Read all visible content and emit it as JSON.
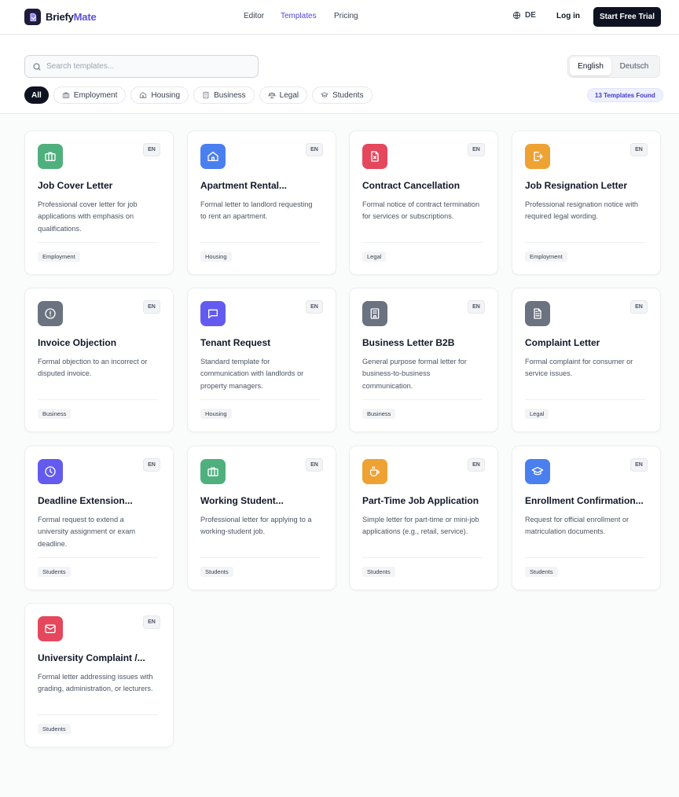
{
  "brand": {
    "name_part1": "Briefy",
    "name_part2": "Mate",
    "accent": "#5b4fe0"
  },
  "nav": {
    "editor": "Editor",
    "templates": "Templates",
    "pricing": "Pricing"
  },
  "header": {
    "language_toggle": "DE",
    "login": "Log in",
    "cta": "Start Free Trial"
  },
  "search": {
    "placeholder": "Search templates...",
    "value": ""
  },
  "language_options": [
    "English",
    "Deutsch"
  ],
  "selected_language": "English",
  "filters": [
    "All",
    "Employment",
    "Housing",
    "Business",
    "Legal",
    "Students"
  ],
  "active_filter": "All",
  "results_badge": "13 Templates Found",
  "templates": [
    {
      "title": "Job Cover Letter",
      "description": "Professional cover letter for job applications with emphasis on qualifications.",
      "category": "Employment",
      "lang": "EN",
      "icon": "briefcase-icon",
      "color": "#4fb07e"
    },
    {
      "title": "Apartment Rental...",
      "description": "Formal letter to landlord requesting to rent an apartment.",
      "category": "Housing",
      "lang": "EN",
      "icon": "home-icon",
      "color": "#4a7ff0"
    },
    {
      "title": "Contract Cancellation",
      "description": "Formal notice of contract termination for services or subscriptions.",
      "category": "Legal",
      "lang": "EN",
      "icon": "file-x-icon",
      "color": "#e5475d"
    },
    {
      "title": "Job Resignation Letter",
      "description": "Professional resignation notice with required legal wording.",
      "category": "Employment",
      "lang": "EN",
      "icon": "logout-icon",
      "color": "#eea234"
    },
    {
      "title": "Invoice Objection",
      "description": "Formal objection to an incorrect or disputed invoice.",
      "category": "Business",
      "lang": "EN",
      "icon": "alert-circle-icon",
      "color": "#6b7280"
    },
    {
      "title": "Tenant Request",
      "description": "Standard template for communication with landlords or property managers.",
      "category": "Housing",
      "lang": "EN",
      "icon": "message-square-icon",
      "color": "#635bf0"
    },
    {
      "title": "Business Letter B2B",
      "description": "General purpose formal letter for business-to-business communication.",
      "category": "Business",
      "lang": "EN",
      "icon": "building-icon",
      "color": "#6b7280"
    },
    {
      "title": "Complaint Letter",
      "description": "Formal complaint for consumer or service issues.",
      "category": "Legal",
      "lang": "EN",
      "icon": "file-text-icon",
      "color": "#6b7280"
    },
    {
      "title": "Deadline Extension...",
      "description": "Formal request to extend a university assignment or exam deadline.",
      "category": "Students",
      "lang": "EN",
      "icon": "clock-icon",
      "color": "#635bf0"
    },
    {
      "title": "Working Student...",
      "description": "Professional letter for applying to a working-student job.",
      "category": "Students",
      "lang": "EN",
      "icon": "briefcase-icon",
      "color": "#4fb07e"
    },
    {
      "title": "Part-Time Job Application",
      "description": "Simple letter for part-time or mini-job applications (e.g., retail, service).",
      "category": "Students",
      "lang": "EN",
      "icon": "coffee-icon",
      "color": "#eea234"
    },
    {
      "title": "Enrollment Confirmation...",
      "description": "Request for official enrollment or matriculation documents.",
      "category": "Students",
      "lang": "EN",
      "icon": "graduation-cap-icon",
      "color": "#4a7ff0"
    },
    {
      "title": "University Complaint /...",
      "description": "Formal letter addressing issues with grading, administration, or lecturers.",
      "category": "Students",
      "lang": "EN",
      "icon": "mail-icon",
      "color": "#e5475d"
    }
  ]
}
